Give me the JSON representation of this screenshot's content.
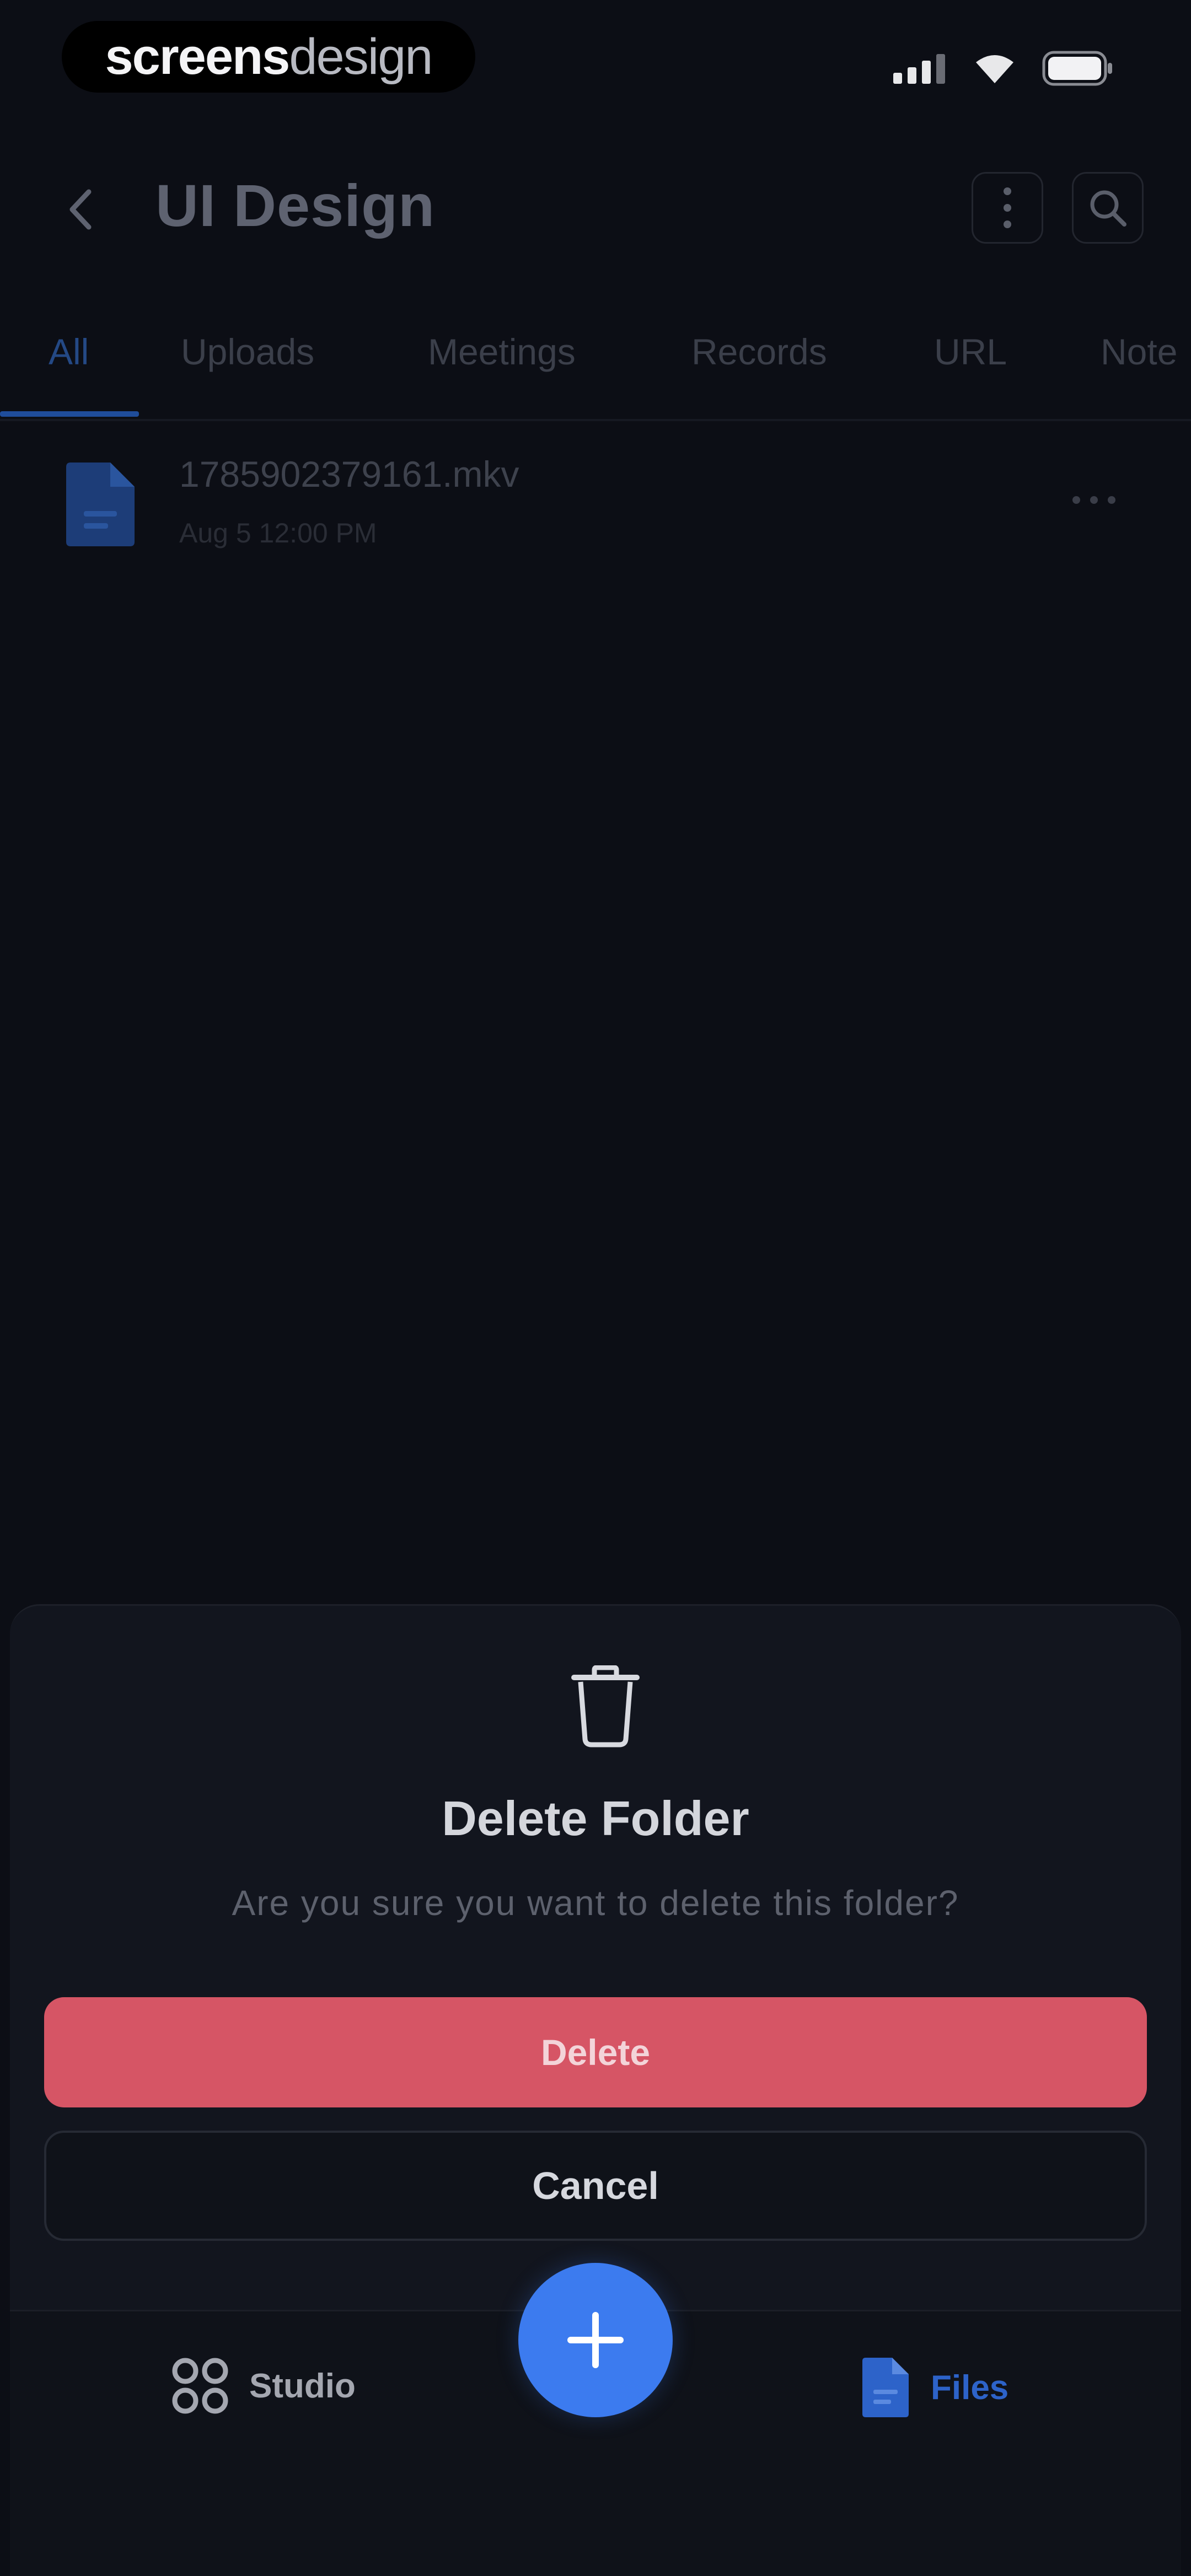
{
  "status_bar": {
    "brand_part1": "screens",
    "brand_part2": "design",
    "icons": [
      "cellular-signal-icon",
      "wifi-icon",
      "battery-icon"
    ]
  },
  "header": {
    "title": "UI Design",
    "icons": [
      "chevron-left-icon",
      "more-vertical-icon",
      "search-icon"
    ]
  },
  "tabs": [
    {
      "label": "All",
      "active": true
    },
    {
      "label": "Uploads",
      "active": false
    },
    {
      "label": "Meetings",
      "active": false
    },
    {
      "label": "Records",
      "active": false
    },
    {
      "label": "URL",
      "active": false
    },
    {
      "label": "Note",
      "active": false
    }
  ],
  "files": [
    {
      "name": "1785902379161.mkv",
      "date": "Aug 5 12:00 PM",
      "icon": "document-icon"
    }
  ],
  "dialog": {
    "icon": "trash-icon",
    "title": "Delete Folder",
    "message": "Are you sure you want to delete this folder?",
    "confirm_label": "Delete",
    "cancel_label": "Cancel"
  },
  "bottom_nav": {
    "studio_label": "Studio",
    "files_label": "Files",
    "fab_icon": "plus-icon"
  },
  "colors": {
    "background": "#0c0e15",
    "sheet": "#12151e",
    "danger": "#d65565",
    "accent": "#3c7bef",
    "active_nav": "#2d63c9"
  }
}
